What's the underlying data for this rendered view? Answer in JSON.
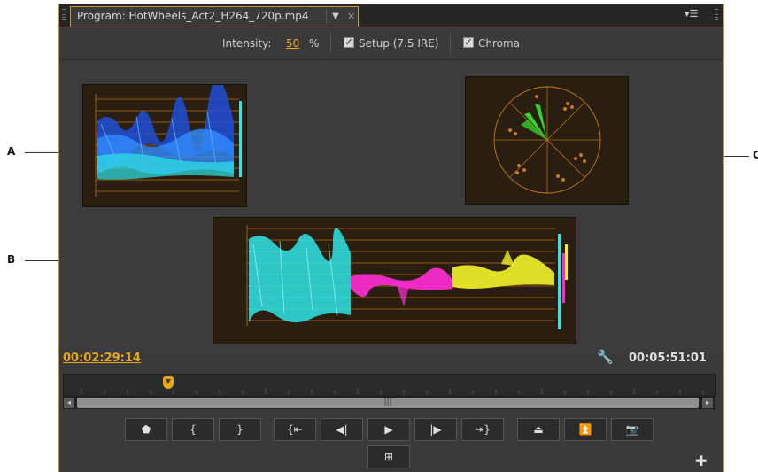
{
  "callouts": {
    "a": "A",
    "b": "B",
    "c": "C"
  },
  "tab": {
    "title": "Program: HotWheels_Act2_H264_720p.mp4",
    "menu_icon": "dropdown-arrow-icon",
    "close_icon": "close-icon"
  },
  "panel_menu_icon": "panel-menu-icon",
  "toolbar": {
    "intensity_label": "Intensity:",
    "intensity_value": "50",
    "intensity_unit": "%",
    "setup_label": "Setup (7.5 IRE)",
    "setup_checked": true,
    "chroma_label": "Chroma",
    "chroma_checked": true
  },
  "timecode": {
    "current": "00:02:29:14",
    "duration": "00:05:51:01"
  },
  "transport": {
    "buttons": [
      "add-marker-button",
      "mark-in-button",
      "mark-out-button",
      "go-to-in-button",
      "step-back-button",
      "play-button",
      "step-forward-button",
      "go-to-out-button",
      "lift-button",
      "extract-button",
      "export-frame-button",
      "safe-margins-button"
    ]
  },
  "colors": {
    "accent": "#e8a820",
    "panel": "#3a3a3a",
    "waveform_luma": "#2f7bff",
    "parade_cyan": "#2ee5e8",
    "parade_magenta": "#ff2bd6",
    "parade_yellow": "#f2f22a",
    "vectorscope": "#37e62f"
  }
}
